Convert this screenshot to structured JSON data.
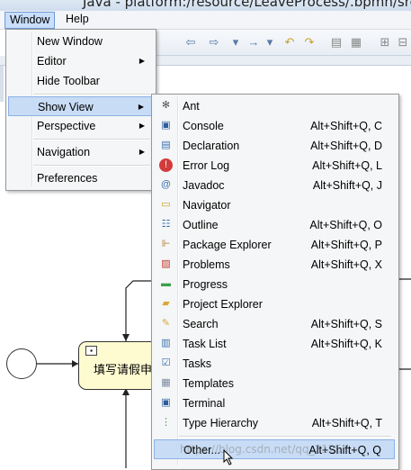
{
  "window": {
    "title": "Java - platform:/resource/LeaveProcess/.bpmn/src"
  },
  "menubar": {
    "window": "Window",
    "help": "Help"
  },
  "window_menu": {
    "items": [
      {
        "label": "New Window",
        "has_submenu": false
      },
      {
        "label": "Editor",
        "has_submenu": true
      },
      {
        "label": "Hide Toolbar",
        "has_submenu": false
      },
      {
        "label": "Show View",
        "has_submenu": true,
        "selected": true
      },
      {
        "label": "Perspective",
        "has_submenu": true
      },
      {
        "label": "Navigation",
        "has_submenu": true
      },
      {
        "label": "Preferences",
        "has_submenu": false
      }
    ]
  },
  "show_view_menu": {
    "items": [
      {
        "label": "Ant",
        "shortcut": "",
        "icon": "ant-icon",
        "color": "#555555"
      },
      {
        "label": "Console",
        "shortcut": "Alt+Shift+Q, C",
        "icon": "console-icon",
        "color": "#2b5d9c"
      },
      {
        "label": "Declaration",
        "shortcut": "Alt+Shift+Q, D",
        "icon": "declaration-icon",
        "color": "#3a6fb0"
      },
      {
        "label": "Error Log",
        "shortcut": "Alt+Shift+Q, L",
        "icon": "error-log-icon",
        "color": "#d23b3b"
      },
      {
        "label": "Javadoc",
        "shortcut": "Alt+Shift+Q, J",
        "icon": "javadoc-icon",
        "color": "#3a6fb0"
      },
      {
        "label": "Navigator",
        "shortcut": "",
        "icon": "navigator-icon",
        "color": "#c9a227"
      },
      {
        "label": "Outline",
        "shortcut": "Alt+Shift+Q, O",
        "icon": "outline-icon",
        "color": "#3a6fb0"
      },
      {
        "label": "Package Explorer",
        "shortcut": "Alt+Shift+Q, P",
        "icon": "package-explorer-icon",
        "color": "#b5762a"
      },
      {
        "label": "Problems",
        "shortcut": "Alt+Shift+Q, X",
        "icon": "problems-icon",
        "color": "#c0392b"
      },
      {
        "label": "Progress",
        "shortcut": "",
        "icon": "progress-icon",
        "color": "#3aa14a"
      },
      {
        "label": "Project Explorer",
        "shortcut": "",
        "icon": "project-explorer-icon",
        "color": "#d8a93a"
      },
      {
        "label": "Search",
        "shortcut": "Alt+Shift+Q, S",
        "icon": "search-icon",
        "color": "#d8a93a"
      },
      {
        "label": "Task List",
        "shortcut": "Alt+Shift+Q, K",
        "icon": "task-list-icon",
        "color": "#3a6fb0"
      },
      {
        "label": "Tasks",
        "shortcut": "",
        "icon": "tasks-icon",
        "color": "#3a6fb0"
      },
      {
        "label": "Templates",
        "shortcut": "",
        "icon": "templates-icon",
        "color": "#7a8aa0"
      },
      {
        "label": "Terminal",
        "shortcut": "",
        "icon": "terminal-icon",
        "color": "#2b5d9c"
      },
      {
        "label": "Type Hierarchy",
        "shortcut": "Alt+Shift+Q, T",
        "icon": "type-hierarchy-icon",
        "color": "#3aa14a"
      },
      {
        "label": "Other...",
        "shortcut": "Alt+Shift+Q, Q",
        "icon": "",
        "color": ""
      }
    ]
  },
  "diagram": {
    "task_label": "填写请假申请"
  },
  "watermark": "https://blog.csdn.net/qq_2125"
}
